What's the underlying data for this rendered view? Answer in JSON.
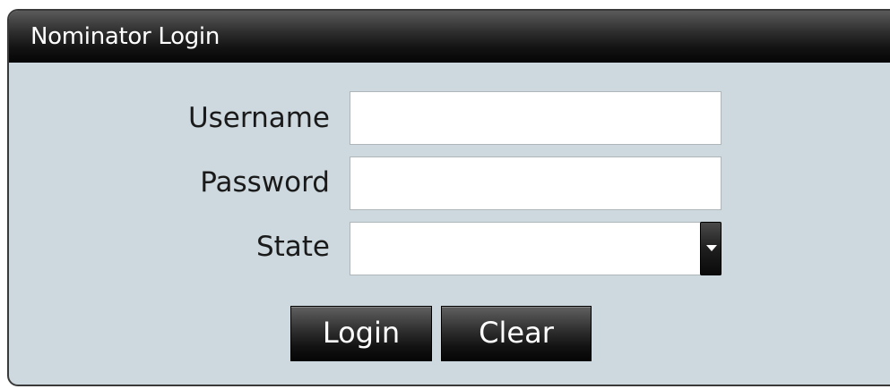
{
  "dialog": {
    "title": "Nominator Login"
  },
  "form": {
    "username": {
      "label": "Username",
      "value": "",
      "placeholder": ""
    },
    "password": {
      "label": "Password",
      "value": "",
      "placeholder": ""
    },
    "state": {
      "label": "State",
      "selected_value": ""
    }
  },
  "actions": {
    "login_label": "Login",
    "clear_label": "Clear"
  },
  "icons": {
    "dropdown": "chevron-down-icon"
  },
  "colors": {
    "panel_background": "#cdd9de",
    "titlebar": "#141414",
    "button": "#1e1e1e",
    "button_text": "#ffffff"
  }
}
